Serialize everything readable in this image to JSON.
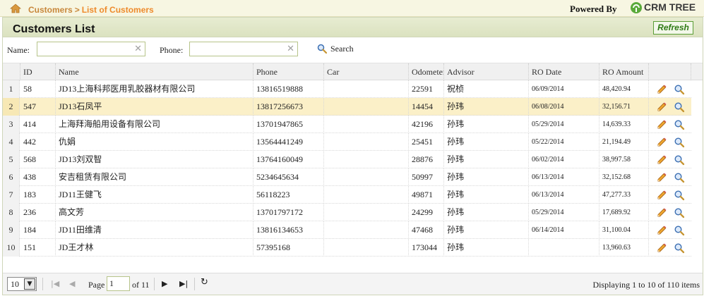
{
  "breadcrumb": {
    "root": "Customers",
    "separator": ">",
    "current": "List of Customers"
  },
  "branding": {
    "powered_by": "Powered By",
    "logo_text": "CRM TREE"
  },
  "panel": {
    "title": "Customers List",
    "refresh_label": "Refresh"
  },
  "search": {
    "name_label": "Name:",
    "name_value": "",
    "phone_label": "Phone:",
    "phone_value": "",
    "search_label": "Search"
  },
  "columns": [
    "ID",
    "Name",
    "Phone",
    "Car",
    "Odometer",
    "Advisor",
    "RO Date",
    "RO Amount"
  ],
  "rows": [
    {
      "n": "1",
      "id": "58",
      "name": "JD13上海科邦医用乳胶器材有限公司",
      "phone": "13816519888",
      "car": "",
      "odometer": "22591",
      "advisor": "祝桢",
      "ro_date": "06/09/2014",
      "ro_amount": "48,420.94"
    },
    {
      "n": "2",
      "id": "547",
      "name": "JD13石凤平",
      "phone": "13817256673",
      "car": "",
      "odometer": "14454",
      "advisor": "孙玮",
      "ro_date": "06/08/2014",
      "ro_amount": "32,156.71"
    },
    {
      "n": "3",
      "id": "414",
      "name": "上海拜海船用设备有限公司",
      "phone": "13701947865",
      "car": "",
      "odometer": "42196",
      "advisor": "孙玮",
      "ro_date": "05/29/2014",
      "ro_amount": "14,639.33"
    },
    {
      "n": "4",
      "id": "442",
      "name": "仇娟",
      "phone": "13564441249",
      "car": "",
      "odometer": "25451",
      "advisor": "孙玮",
      "ro_date": "05/22/2014",
      "ro_amount": "21,194.49"
    },
    {
      "n": "5",
      "id": "568",
      "name": "JD13刘双智",
      "phone": "13764160049",
      "car": "",
      "odometer": "28876",
      "advisor": "孙玮",
      "ro_date": "06/02/2014",
      "ro_amount": "38,997.58"
    },
    {
      "n": "6",
      "id": "438",
      "name": "安吉租赁有限公司",
      "phone": "5234645634",
      "car": "",
      "odometer": "50997",
      "advisor": "孙玮",
      "ro_date": "06/13/2014",
      "ro_amount": "32,152.68"
    },
    {
      "n": "7",
      "id": "183",
      "name": "JD11王健飞",
      "phone": "56118223",
      "car": "",
      "odometer": "49871",
      "advisor": "孙玮",
      "ro_date": "06/13/2014",
      "ro_amount": "47,277.33"
    },
    {
      "n": "8",
      "id": "236",
      "name": "高文芳",
      "phone": "13701797172",
      "car": "",
      "odometer": "24299",
      "advisor": "孙玮",
      "ro_date": "05/29/2014",
      "ro_amount": "17,689.92"
    },
    {
      "n": "9",
      "id": "184",
      "name": "JD11田维清",
      "phone": "13816134653",
      "car": "",
      "odometer": "47468",
      "advisor": "孙玮",
      "ro_date": "06/14/2014",
      "ro_amount": "31,100.04"
    },
    {
      "n": "10",
      "id": "151",
      "name": "JD王才林",
      "phone": "57395168",
      "car": "",
      "odometer": "173044",
      "advisor": "孙玮",
      "ro_date": "",
      "ro_amount": "13,960.63"
    }
  ],
  "selected_row": 1,
  "pager": {
    "page_size": "10",
    "page_label": "Page",
    "current_page": "1",
    "of_label": "of 11",
    "display_info": "Displaying 1 to 10 of 110 items"
  },
  "colors": {
    "accent_orange": "#ee8a2b",
    "header_green": "#dbe2c0",
    "selected_row": "#fbf0c8",
    "refresh_green": "#2e7a14"
  },
  "icons": {
    "home": "home-icon",
    "logo": "crm-tree-logo-icon",
    "search": "search-icon",
    "clear": "clear-icon",
    "edit": "pencil-icon",
    "view": "magnifier-icon"
  }
}
